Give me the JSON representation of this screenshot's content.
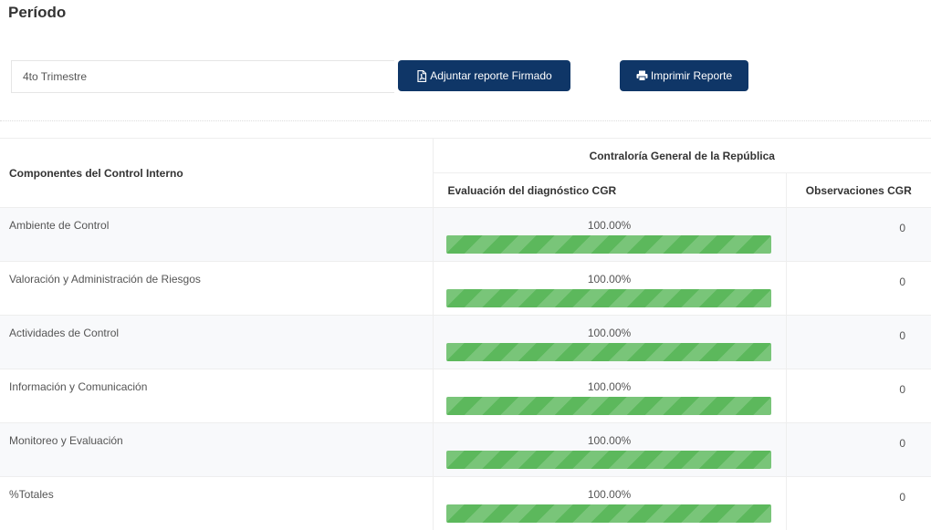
{
  "page": {
    "title": "Período"
  },
  "period": {
    "value": "4to Trimestre"
  },
  "buttons": {
    "attach_label": "Adjuntar reporte Firmado",
    "print_label": "Imprimir Reporte"
  },
  "table": {
    "header_components": "Componentes del Control Interno",
    "header_group": "Contraloría General de la República",
    "header_eval": "Evaluación del diagnóstico CGR",
    "header_obs": "Observaciones CGR",
    "rows": [
      {
        "name": "Ambiente de Control",
        "pct": "100.00%",
        "fill": 1.0,
        "obs": "0"
      },
      {
        "name": "Valoración y Administración de Riesgos",
        "pct": "100.00%",
        "fill": 1.0,
        "obs": "0"
      },
      {
        "name": "Actividades de Control",
        "pct": "100.00%",
        "fill": 1.0,
        "obs": "0"
      },
      {
        "name": "Información y Comunicación",
        "pct": "100.00%",
        "fill": 1.0,
        "obs": "0"
      },
      {
        "name": "Monitoreo y Evaluación",
        "pct": "100.00%",
        "fill": 1.0,
        "obs": "0"
      },
      {
        "name": "%Totales",
        "pct": "100.00%",
        "fill": 1.0,
        "obs": "0"
      }
    ]
  },
  "colors": {
    "button_bg": "#0f3667",
    "progress_fill": "#5cb85c"
  },
  "icons": {
    "attach": "file-pdf-icon",
    "print": "printer-icon"
  }
}
